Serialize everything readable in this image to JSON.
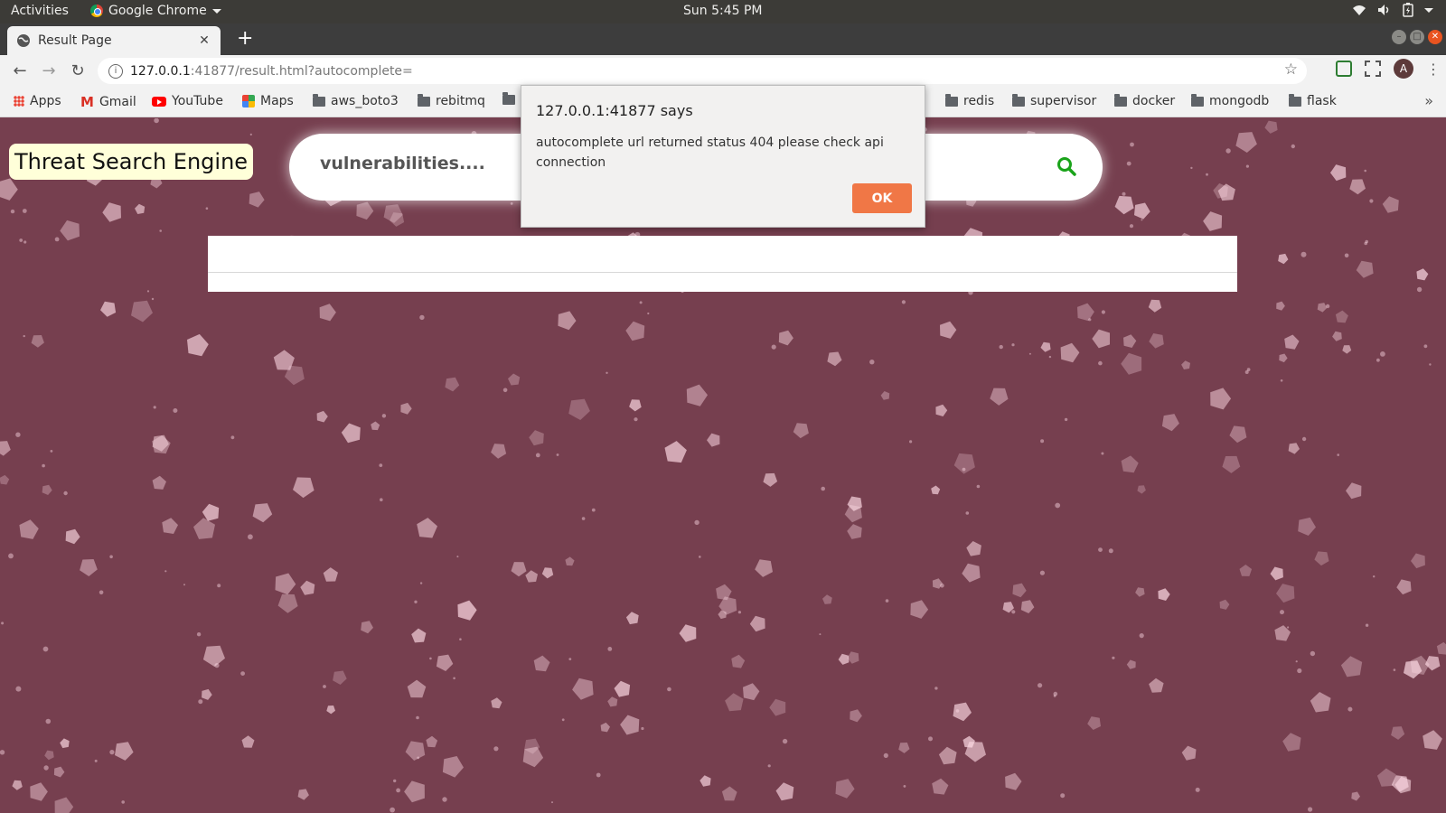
{
  "system_bar": {
    "activities": "Activities",
    "app_name": "Google Chrome",
    "clock": "Sun  5:45 PM"
  },
  "browser": {
    "tab_title": "Result Page",
    "url_host": "127.0.0.1",
    "url_rest": ":41877/result.html?autocomplete=",
    "avatar_letter": "A",
    "bookmarks": [
      "Apps",
      "Gmail",
      "YouTube",
      "Maps",
      "aws_boto3",
      "rebitmq",
      "redis",
      "supervisor",
      "docker",
      "mongodb",
      "flask"
    ]
  },
  "page": {
    "brand": "Threat Search Engine",
    "search_placeholder": "vulnerabilities....",
    "background_color": "#763f4f"
  },
  "dialog": {
    "title": "127.0.0.1:41877 says",
    "message": "autocomplete url returned status 404 please check api connection",
    "ok_label": "OK",
    "ok_color": "#f07746"
  }
}
